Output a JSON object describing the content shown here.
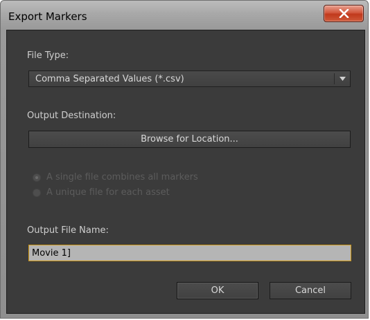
{
  "window": {
    "title": "Export Markers"
  },
  "file_type": {
    "label": "File Type:",
    "selected": "Comma Separated Values (*.csv)"
  },
  "output_destination": {
    "label": "Output Destination:",
    "browse_label": "Browse for Location..."
  },
  "options": [
    {
      "label": "A single file combines all markers",
      "checked": true,
      "enabled": false
    },
    {
      "label": "A unique file for each asset",
      "checked": false,
      "enabled": false
    }
  ],
  "output_file_name": {
    "label": "Output File Name:",
    "value": "Movie 1]"
  },
  "actions": {
    "ok_label": "OK",
    "cancel_label": "Cancel"
  },
  "colors": {
    "panel_background": "#3b3b3b",
    "focus_border": "#d19a16",
    "close_button": "#c0391c"
  }
}
